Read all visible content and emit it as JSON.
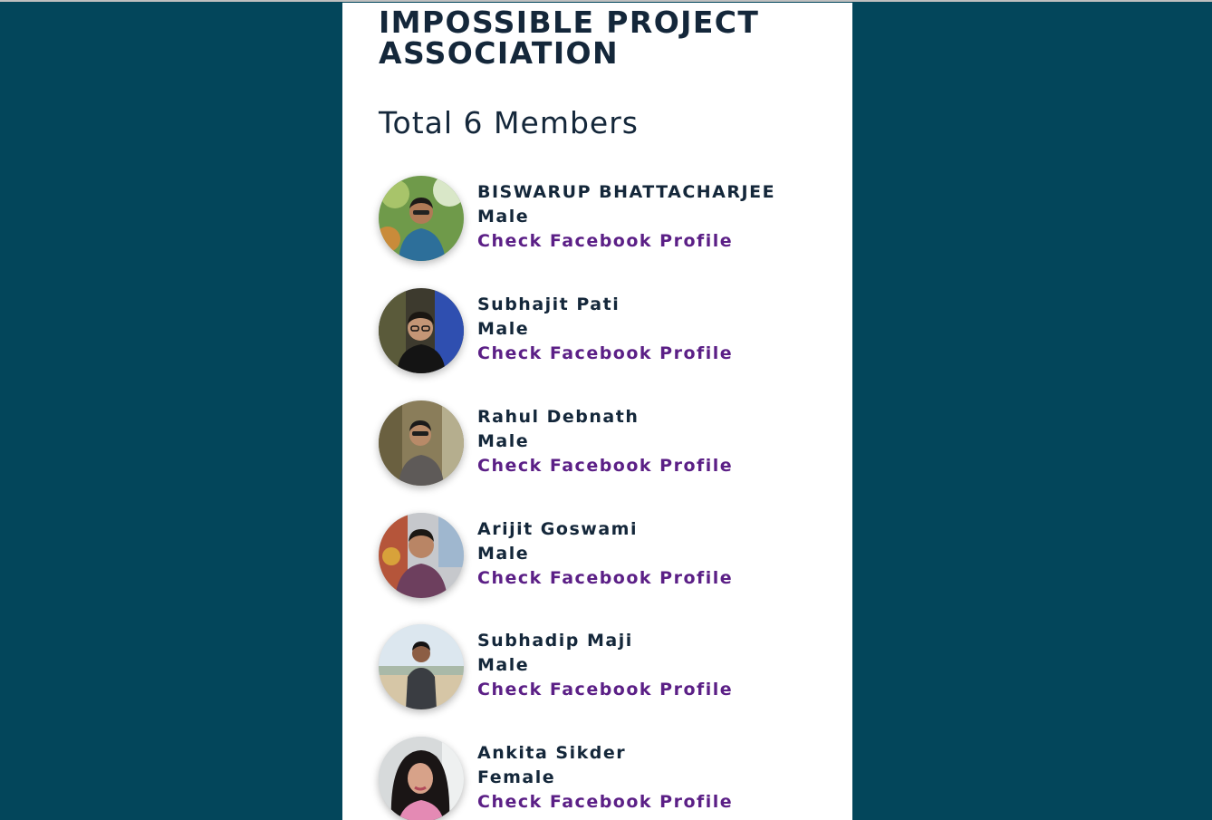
{
  "page": {
    "organization_title": "IMPOSSIBLE PROJECT ASSOCIATION",
    "member_count_text": "Total 6 Members"
  },
  "colors": {
    "page_background": "#03465b",
    "panel_background": "#ffffff",
    "heading_text": "#14273a",
    "link_text": "#5b1f86"
  },
  "members": [
    {
      "name": "BISWARUP BHATTACHARJEE",
      "gender": "Male",
      "link_label": "Check Facebook Profile"
    },
    {
      "name": "Subhajit Pati",
      "gender": "Male",
      "link_label": "Check Facebook Profile"
    },
    {
      "name": "Rahul Debnath",
      "gender": "Male",
      "link_label": "Check Facebook Profile"
    },
    {
      "name": "Arijit Goswami",
      "gender": "Male",
      "link_label": "Check Facebook Profile"
    },
    {
      "name": "Subhadip Maji",
      "gender": "Male",
      "link_label": "Check Facebook Profile"
    },
    {
      "name": "Ankita Sikder",
      "gender": "Female",
      "link_label": "Check Facebook Profile"
    }
  ]
}
